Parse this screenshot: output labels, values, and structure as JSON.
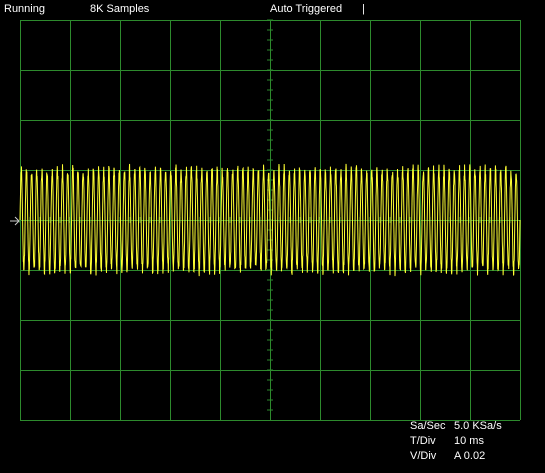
{
  "status_bar": {
    "run_state": "Running",
    "samples": "8K Samples",
    "trigger": "Auto Triggered",
    "cursor_marker": "|"
  },
  "readouts": {
    "sample_rate_label": "Sa/Sec",
    "sample_rate_value": "5.0 KSa/s",
    "time_div_label": "T/Div",
    "time_div_value": "10 ms",
    "volt_div_label": "V/Div",
    "volt_div_value": "A 0.02"
  },
  "display": {
    "trace_color": "#ffff33",
    "grid_color": "#2d8a2d",
    "background_color": "#000000",
    "ground_marker_icon": "right-arrow-icon",
    "h_divisions": 10,
    "v_divisions": 8
  },
  "chart_data": {
    "type": "line",
    "x_divisions": 10,
    "y_divisions": 8,
    "x_per_div_ms": 10,
    "y_per_div": 0.02,
    "series": [
      {
        "y_offset_divisions": 0,
        "amplitude_divisions": 1.0,
        "cycles_on_screen": 97
      }
    ]
  }
}
